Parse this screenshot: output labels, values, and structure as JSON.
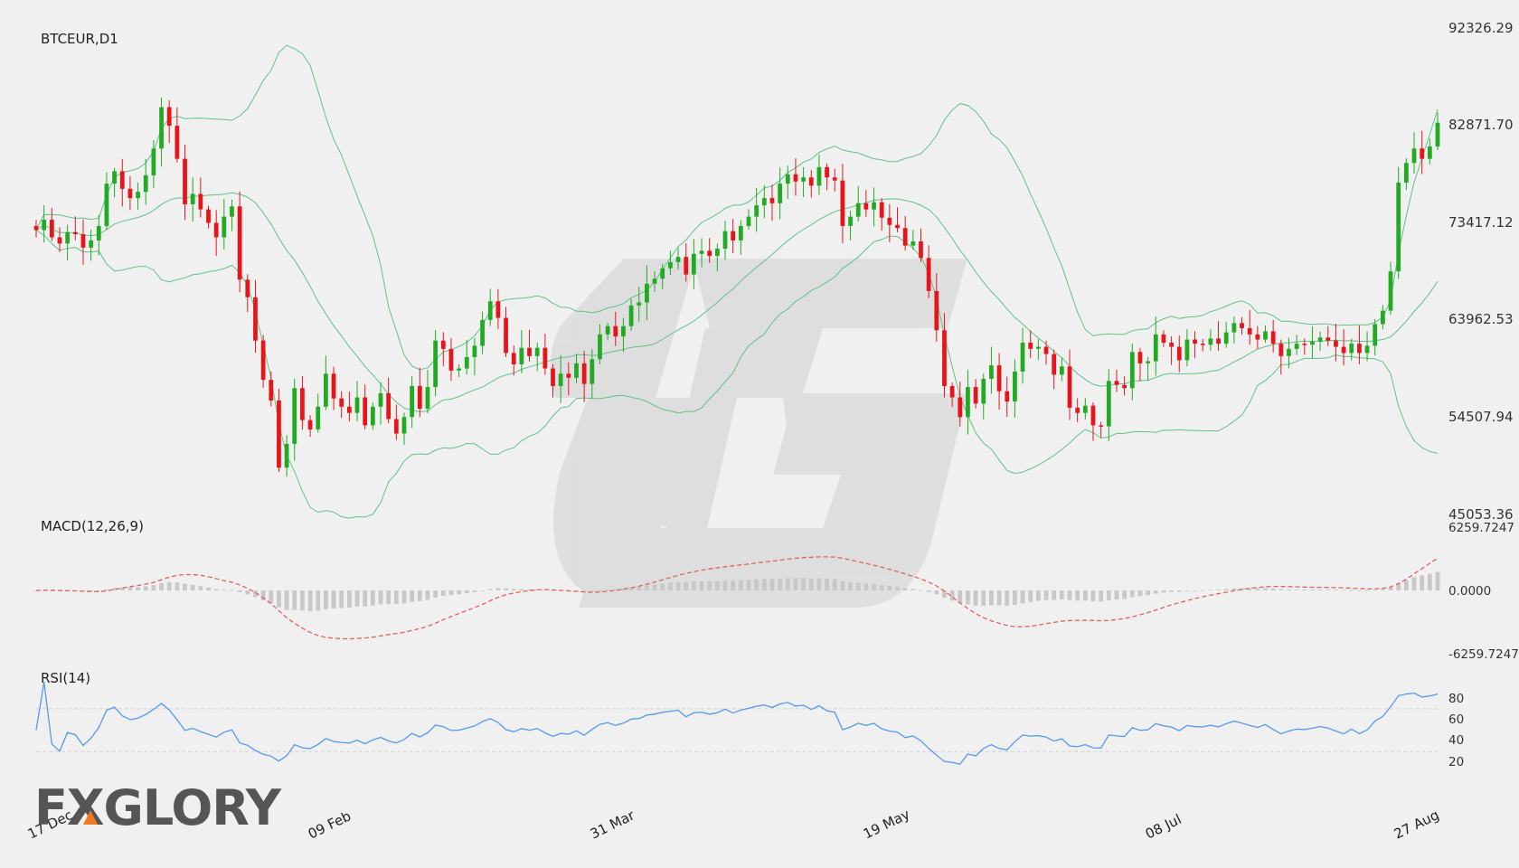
{
  "symbol_label": "BTCEUR,D1",
  "brand": "FXGLORY",
  "colors": {
    "up": "#22aa22",
    "down": "#e8141c",
    "bollinger": "#5fc28a",
    "macd_signal": "#e06060",
    "macd_hist": "#c8c8c8",
    "rsi": "#5599ee",
    "grid": "#cfcfcf"
  },
  "chart_data": [
    {
      "type": "candlestick",
      "title": "BTCEUR,D1",
      "x_labels": [
        "17 Dec",
        "09 Feb",
        "31 Mar",
        "19 May",
        "08 Jul",
        "27 Aug"
      ],
      "y_ticks": [
        "92326.29",
        "82871.70",
        "73417.12",
        "63962.53",
        "54507.94",
        "45053.36"
      ],
      "ylim": [
        45053.36,
        92326.29
      ],
      "indicator": "Bollinger Bands",
      "closes": [
        72500,
        73500,
        71800,
        71200,
        72300,
        72100,
        70800,
        71500,
        72900,
        77000,
        78200,
        76500,
        75600,
        76200,
        77800,
        80400,
        84400,
        82600,
        79400,
        75000,
        76000,
        74500,
        73200,
        71800,
        73800,
        74800,
        67700,
        66000,
        61800,
        58000,
        56000,
        49500,
        51800,
        57200,
        54100,
        53200,
        55400,
        58600,
        56200,
        55400,
        54800,
        56300,
        53600,
        55400,
        56700,
        54200,
        52800,
        54400,
        57400,
        55200,
        57300,
        61800,
        61000,
        58900,
        59100,
        60200,
        61300,
        63800,
        65600,
        64000,
        60600,
        59500,
        61100,
        60300,
        61100,
        59100,
        57400,
        58600,
        58200,
        59600,
        57600,
        60000,
        62400,
        63200,
        62200,
        63200,
        65200,
        65500,
        67300,
        67800,
        68800,
        69400,
        69900,
        68200,
        70200,
        70500,
        70000,
        70700,
        72400,
        71500,
        72900,
        73800,
        74900,
        75600,
        75100,
        77000,
        77900,
        77200,
        77600,
        76800,
        78600,
        77600,
        77300,
        72900,
        73800,
        75100,
        74500,
        75200,
        73700,
        73000,
        72700,
        71000,
        71400,
        69800,
        66600,
        62800,
        57400,
        56300,
        54400,
        57300,
        55700,
        58100,
        59400,
        56900,
        55900,
        58800,
        61600,
        61000,
        61200,
        60500,
        58500,
        59300,
        55300,
        54800,
        55500,
        53600,
        53500,
        57900,
        57500,
        57200,
        60700,
        59600,
        59800,
        62400,
        61600,
        61200,
        59900,
        61900,
        61500,
        61400,
        62000,
        61500,
        62600,
        63500,
        63000,
        62400,
        61900,
        62700,
        61500,
        60300,
        61000,
        61500,
        61400,
        61700,
        62100,
        61800,
        61200,
        60600,
        61500,
        60600,
        61300,
        63400,
        64700,
        68500,
        77100,
        79000,
        80400,
        79400,
        80600,
        82900
      ],
      "series": [
        {
          "name": "MACD(12,26,9)",
          "y_ticks": [
            "6259.7247",
            "0.0000",
            "-6259.7247"
          ]
        },
        {
          "name": "RSI(14)",
          "y_ticks": [
            "80",
            "60",
            "40",
            "20"
          ],
          "reference_levels": [
            30,
            70
          ]
        }
      ]
    }
  ]
}
